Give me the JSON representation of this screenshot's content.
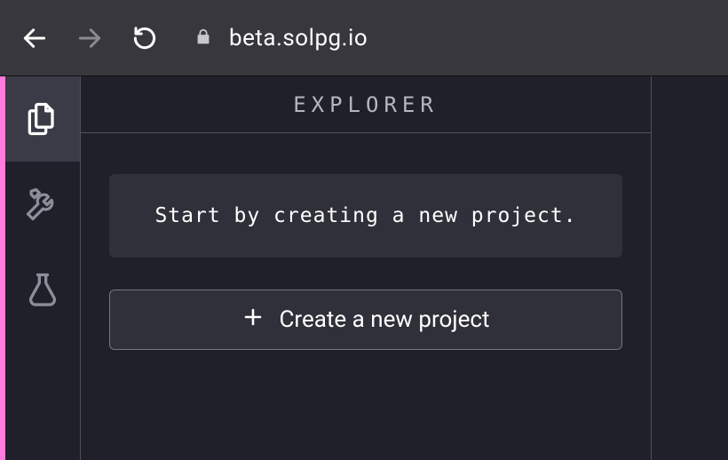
{
  "browser": {
    "url": "beta.solpg.io"
  },
  "explorer": {
    "title": "EXPLORER",
    "hint": "Start by creating a new project.",
    "create_label": "Create a new project"
  }
}
